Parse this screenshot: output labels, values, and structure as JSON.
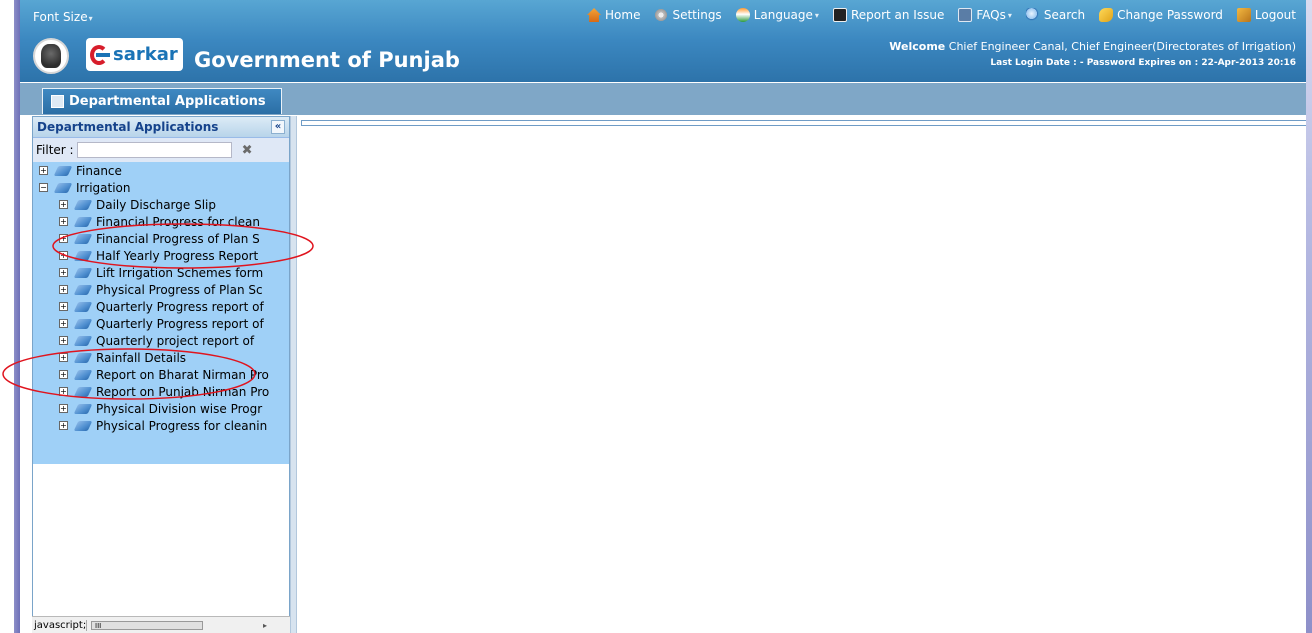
{
  "header": {
    "font_size_label": "Font Size",
    "brand_text": "sarkar",
    "site_title": "Government of Punjab",
    "welcome_prefix": "Welcome",
    "welcome_user": "Chief Engineer Canal, Chief Engineer(Directorates of Irrigation)",
    "login_info": "Last Login Date : - Password Expires on : 22-Apr-2013 20:16"
  },
  "menu": {
    "home": "Home",
    "settings": "Settings",
    "language": "Language",
    "report_issue": "Report an Issue",
    "faqs": "FAQs",
    "search": "Search",
    "change_password": "Change Password",
    "logout": "Logout"
  },
  "tabs": {
    "active": "Departmental Applications"
  },
  "sidebar": {
    "title": "Departmental Applications",
    "filter_label": "Filter :",
    "filter_value": "",
    "tree": [
      {
        "label": "Finance",
        "level": 0,
        "expander": "+"
      },
      {
        "label": "Irrigation",
        "level": 0,
        "expander": "−"
      },
      {
        "label": "Daily Discharge Slip",
        "level": 1,
        "expander": "+"
      },
      {
        "label": "Financial Progress for clean",
        "level": 1,
        "expander": "+"
      },
      {
        "label": "Financial Progress of Plan S",
        "level": 1,
        "expander": "+"
      },
      {
        "label": "Half Yearly Progress Report",
        "level": 1,
        "expander": "+"
      },
      {
        "label": "Lift Irrigation Schemes form",
        "level": 1,
        "expander": "+"
      },
      {
        "label": "Physical Progress of Plan Sc",
        "level": 1,
        "expander": "+"
      },
      {
        "label": "Quarterly Progress report of",
        "level": 1,
        "expander": "+"
      },
      {
        "label": "Quarterly Progress report of",
        "level": 1,
        "expander": "+"
      },
      {
        "label": "Quarterly project report of",
        "level": 1,
        "expander": "+"
      },
      {
        "label": "Rainfall Details",
        "level": 1,
        "expander": "+"
      },
      {
        "label": "Report on Bharat Nirman Pro",
        "level": 1,
        "expander": "+"
      },
      {
        "label": "Report on Punjab Nirman Pro",
        "level": 1,
        "expander": "+"
      },
      {
        "label": "Physical Division wise Progr",
        "level": 1,
        "expander": "+"
      },
      {
        "label": "Physical Progress for cleanin",
        "level": 1,
        "expander": "+"
      }
    ]
  },
  "statusbar": {
    "text": "javascript;"
  },
  "colors": {
    "header_blue": "#3b87c0",
    "tree_highlight": "#9fd0f7",
    "annotation_red": "#e0141e"
  }
}
